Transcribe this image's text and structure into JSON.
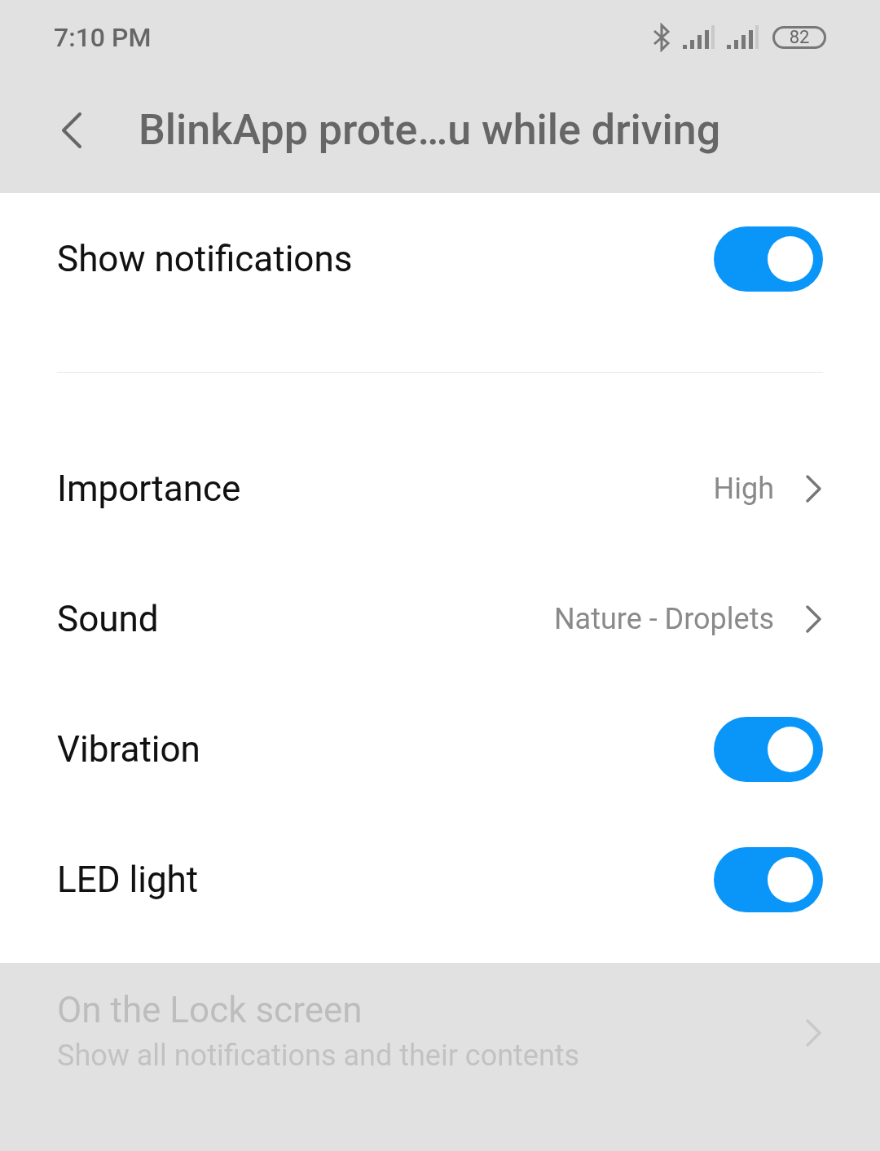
{
  "status_bar": {
    "time": "7:10 PM",
    "battery": "82"
  },
  "header": {
    "title": "BlinkApp prote…u while driving"
  },
  "sections": [
    {
      "items": [
        {
          "kind": "toggle",
          "label": "Show notifications",
          "on": true
        }
      ]
    },
    {
      "items": [
        {
          "kind": "link",
          "label": "Importance",
          "value": "High"
        },
        {
          "kind": "link",
          "label": "Sound",
          "value": "Nature - Droplets"
        },
        {
          "kind": "toggle",
          "label": "Vibration",
          "on": true
        },
        {
          "kind": "toggle",
          "label": "LED light",
          "on": true
        }
      ]
    }
  ],
  "lock_screen": {
    "title": "On the Lock screen",
    "subtitle": "Show all notifications and their contents",
    "disabled": true
  }
}
